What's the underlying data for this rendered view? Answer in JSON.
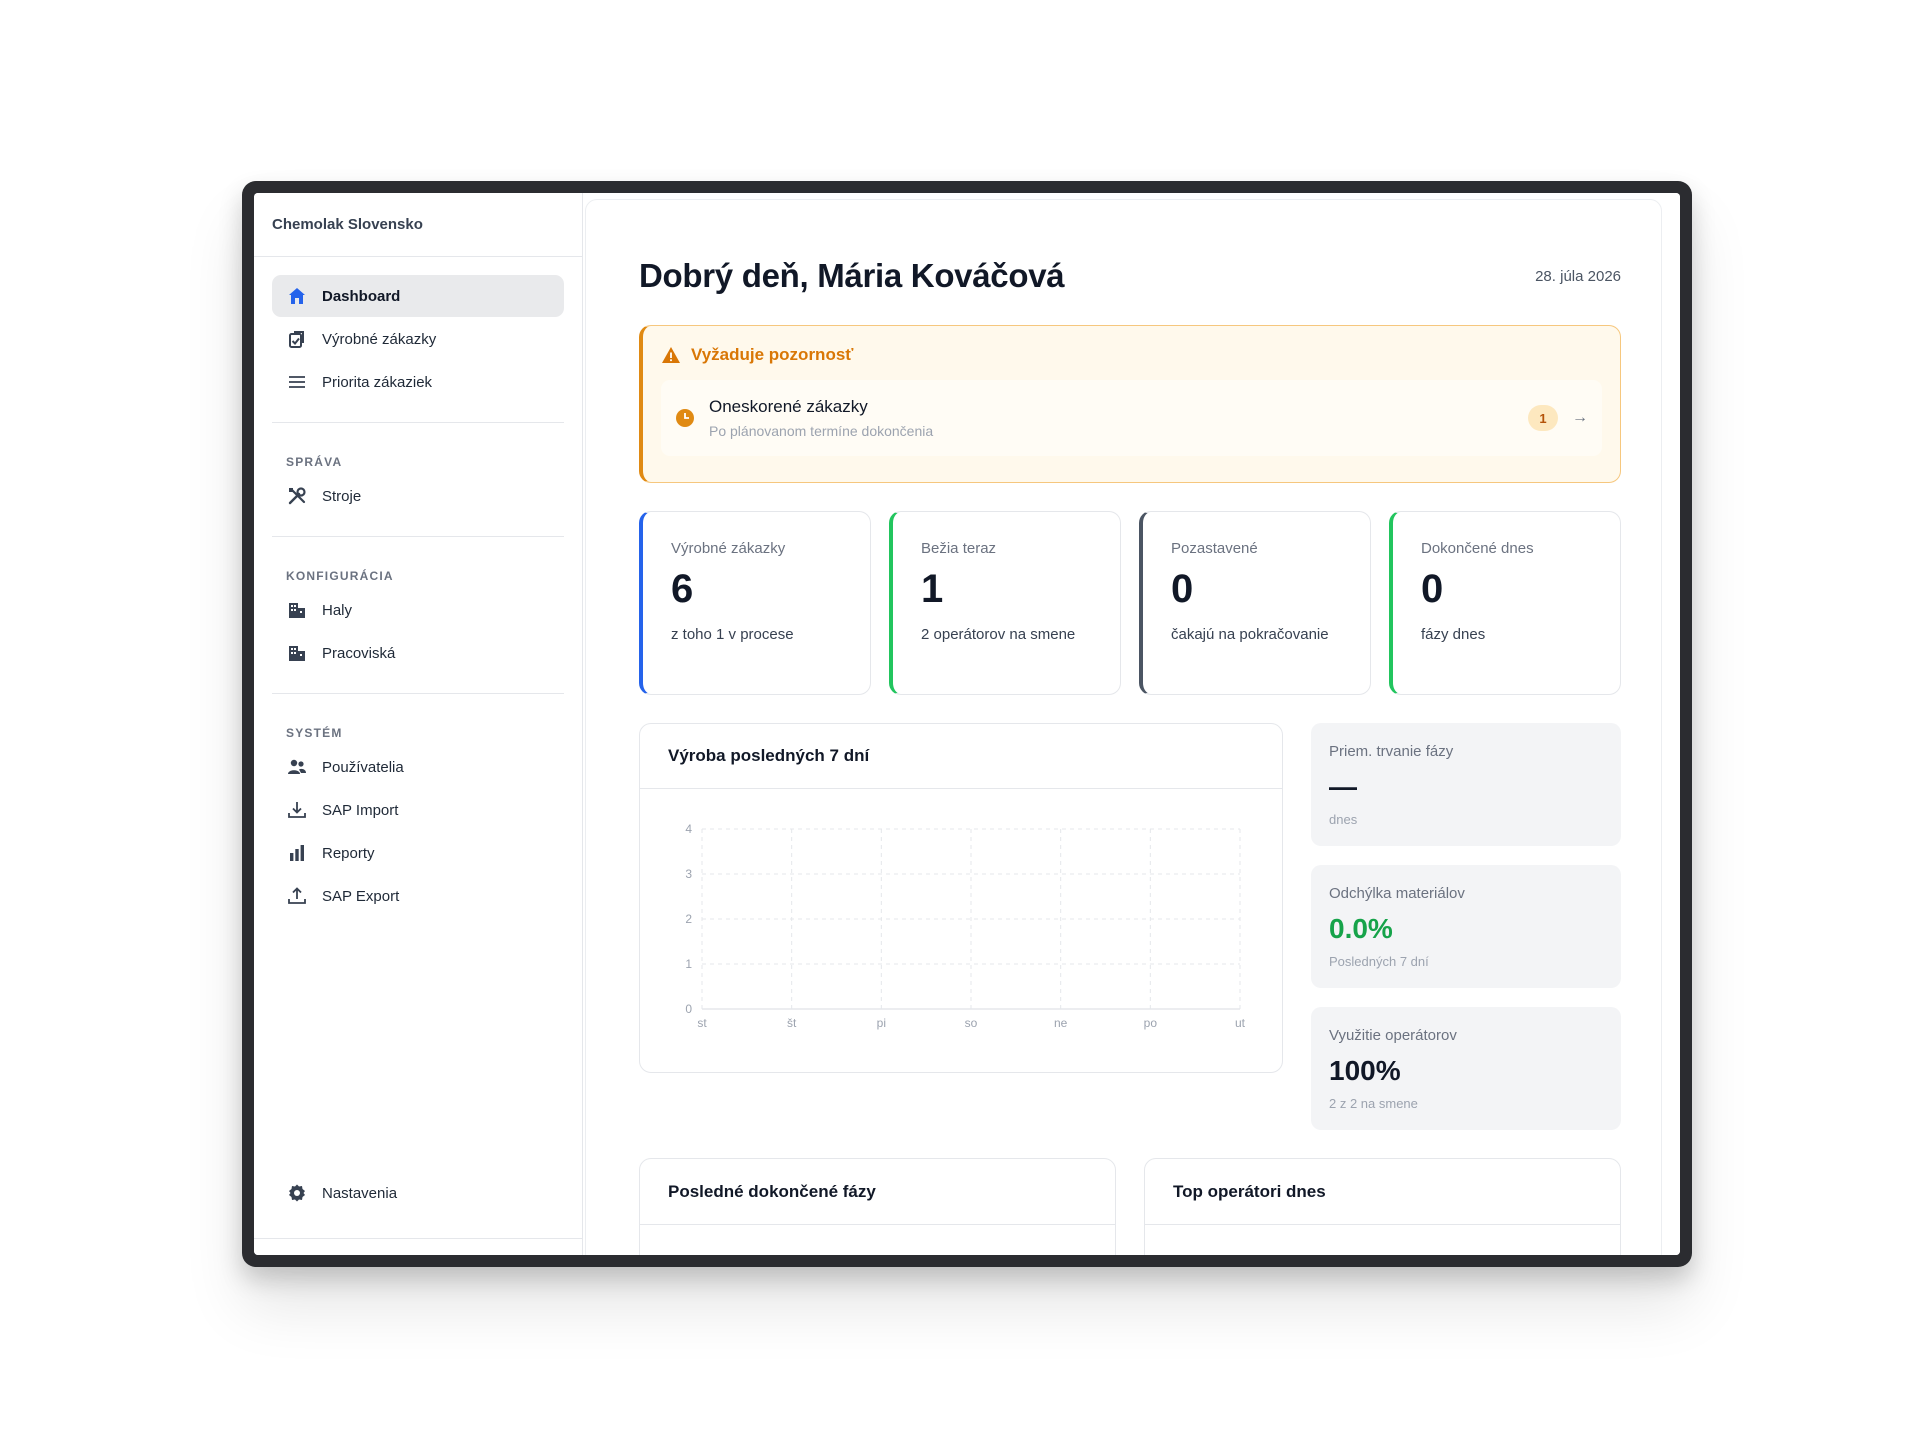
{
  "sidebar": {
    "brand": "Chemolak Slovensko",
    "main_items": [
      {
        "label": "Dashboard",
        "icon": "home-icon",
        "active": true
      },
      {
        "label": "Výrobné zákazky",
        "icon": "orders-icon"
      },
      {
        "label": "Priorita zákaziek",
        "icon": "list-icon"
      }
    ],
    "groups": [
      {
        "title": "SPRÁVA",
        "items": [
          {
            "label": "Stroje",
            "icon": "tools-icon"
          }
        ]
      },
      {
        "title": "KONFIGURÁCIA",
        "items": [
          {
            "label": "Haly",
            "icon": "building-icon"
          },
          {
            "label": "Pracoviská",
            "icon": "building-icon"
          }
        ]
      },
      {
        "title": "SYSTÉM",
        "items": [
          {
            "label": "Používatelia",
            "icon": "users-icon"
          },
          {
            "label": "SAP Import",
            "icon": "download-icon"
          },
          {
            "label": "Reporty",
            "icon": "bar-chart-icon"
          },
          {
            "label": "SAP Export",
            "icon": "upload-icon"
          }
        ]
      }
    ],
    "settings_label": "Nastavenia"
  },
  "header": {
    "greeting": "Dobrý deň, Mária Kováčová",
    "date": "28. júla 2026"
  },
  "alert": {
    "title": "Vyžaduje pozornosť",
    "row_title": "Oneskorené zákazky",
    "row_subtitle": "Po plánovanom termíne dokončenia",
    "count": "1",
    "accent": "#e08a13"
  },
  "stats": [
    {
      "label": "Výrobné zákazky",
      "value": "6",
      "sub": "z toho 1 v procese",
      "color": "#2563eb"
    },
    {
      "label": "Bežia teraz",
      "value": "1",
      "sub": "2 operátorov na smene",
      "color": "#22c55e"
    },
    {
      "label": "Pozastavené",
      "value": "0",
      "sub": "čakajú na pokračovanie",
      "color": "#4b5563"
    },
    {
      "label": "Dokončené dnes",
      "value": "0",
      "sub": "fázy dnes",
      "color": "#22c55e"
    }
  ],
  "chart": {
    "title": "Výroba posledných 7 dní"
  },
  "chart_data": {
    "type": "line",
    "categories": [
      "st",
      "št",
      "pi",
      "so",
      "ne",
      "po",
      "ut"
    ],
    "series": [
      {
        "values": [
          0,
          0,
          0,
          0,
          0,
          0,
          0
        ]
      }
    ],
    "yticks": [
      "0",
      "1",
      "2",
      "3",
      "4"
    ],
    "ylim": [
      0,
      4
    ],
    "title": "Výroba posledných 7 dní",
    "grid": true
  },
  "metrics": [
    {
      "label": "Priem. trvanie fázy",
      "value": "—",
      "sub": "dnes",
      "tone": "default"
    },
    {
      "label": "Odchýlka materiálov",
      "value": "0.0%",
      "sub": "Posledných 7 dní",
      "tone": "green"
    },
    {
      "label": "Využitie operátorov",
      "value": "100%",
      "sub": "2 z 2 na smene",
      "tone": "default"
    }
  ],
  "bottom": {
    "left_title": "Posledné dokončené fázy",
    "right_title": "Top operátori dnes"
  }
}
